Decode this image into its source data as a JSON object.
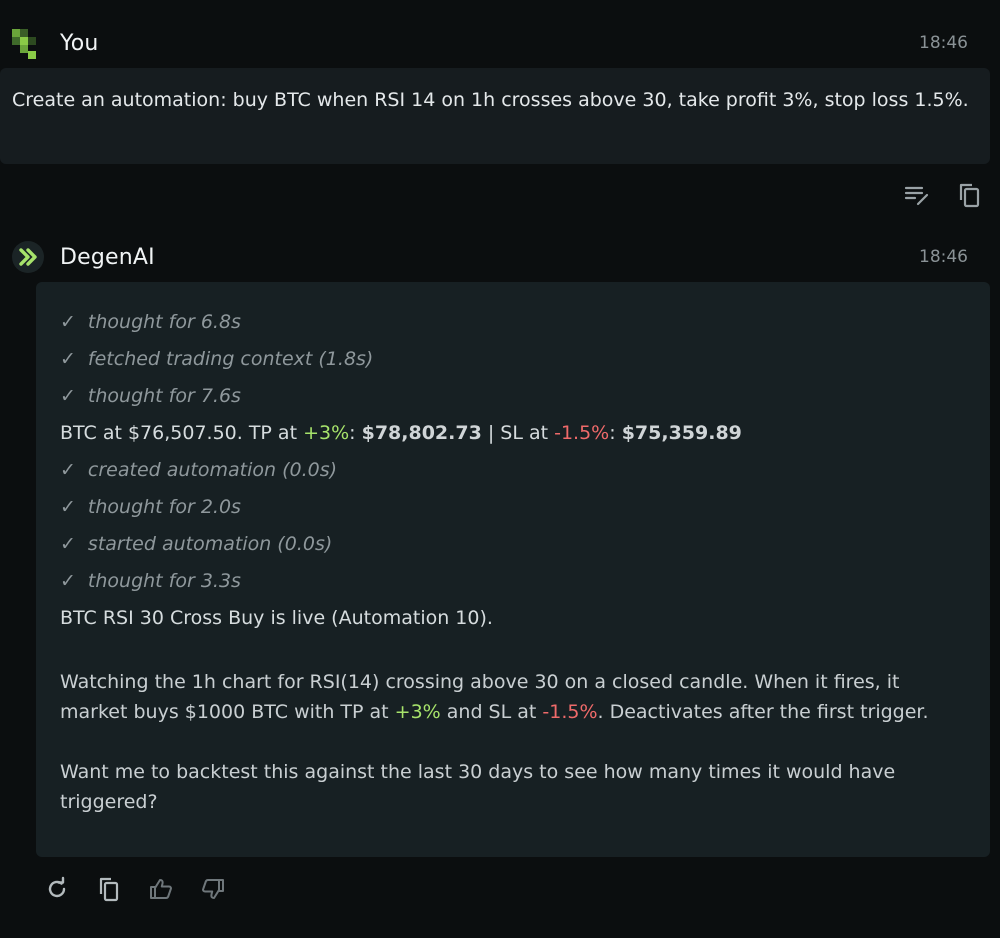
{
  "user": {
    "name": "You",
    "time": "18:46",
    "message": "Create an automation: buy BTC when RSI 14 on 1h crosses above 30, take profit 3%, stop loss 1.5%."
  },
  "assistant": {
    "name": "DegenAI",
    "time": "18:46",
    "steps_top": [
      "thought for 6.8s",
      "fetched trading context (1.8s)",
      "thought for 7.6s"
    ],
    "price_line": {
      "prefix": "BTC at $76,507.50. TP at ",
      "tp_pct": "+3%",
      "sep1": ": ",
      "tp_price": "$78,802.73",
      "mid": " | SL at ",
      "sl_pct": "-1.5%",
      "sep2": ": ",
      "sl_price": "$75,359.89"
    },
    "steps_bottom": [
      "created automation (0.0s)",
      "thought for 2.0s",
      "started automation (0.0s)",
      "thought for 3.3s"
    ],
    "live_line": "BTC RSI 30 Cross Buy is live (Automation 10).",
    "watch_para": {
      "part1": "Watching the 1h chart for RSI(14) crossing above 30 on a closed candle. When it fires, it market buys $1000 BTC with TP at ",
      "tp": "+3%",
      "part2": " and SL at ",
      "sl": "-1.5%",
      "part3": ". Deactivates after the first trigger."
    },
    "question": "Want me to backtest this against the last 30 days to see how many times it would have triggered?"
  },
  "icons": {
    "check": "✓",
    "edit": "edit-icon",
    "copy": "copy-icon",
    "regenerate": "refresh-icon",
    "thumbs_up": "thumbs-up-icon",
    "thumbs_down": "thumbs-down-icon"
  },
  "colors": {
    "accent_green": "#a7e36b",
    "negative_red": "#ef6a6a",
    "logo_green": "#7fbf3f"
  }
}
